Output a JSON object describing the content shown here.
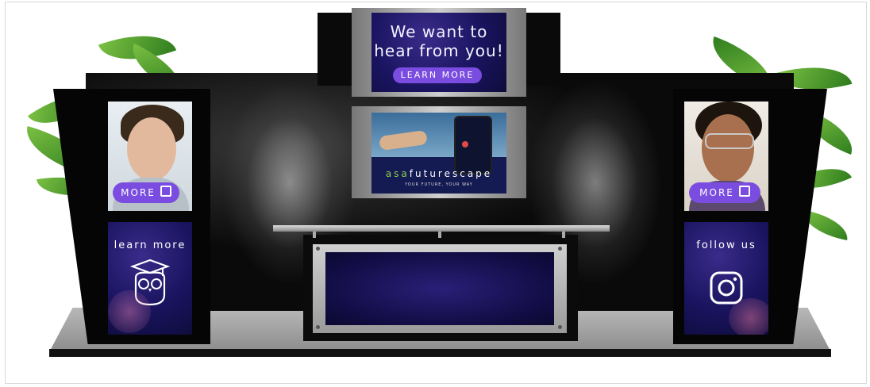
{
  "top_screen": {
    "headline_line1": "We want to",
    "headline_line2": "hear from you!",
    "cta_label": "LEARN MORE"
  },
  "video_screen": {
    "brand_prefix": "asa",
    "brand_name": "futurescape",
    "tagline": "YOUR FUTURE, YOUR WAY"
  },
  "left_photo": {
    "more_label": "MORE"
  },
  "right_photo": {
    "more_label": "MORE"
  },
  "left_panel": {
    "label": "learn more",
    "icon": "owl-icon"
  },
  "right_panel": {
    "label": "follow us",
    "icon": "instagram-icon"
  },
  "colors": {
    "accent": "#7a4ce0",
    "screen_bg": "#1a1460",
    "brand_green": "#8fd14f"
  }
}
